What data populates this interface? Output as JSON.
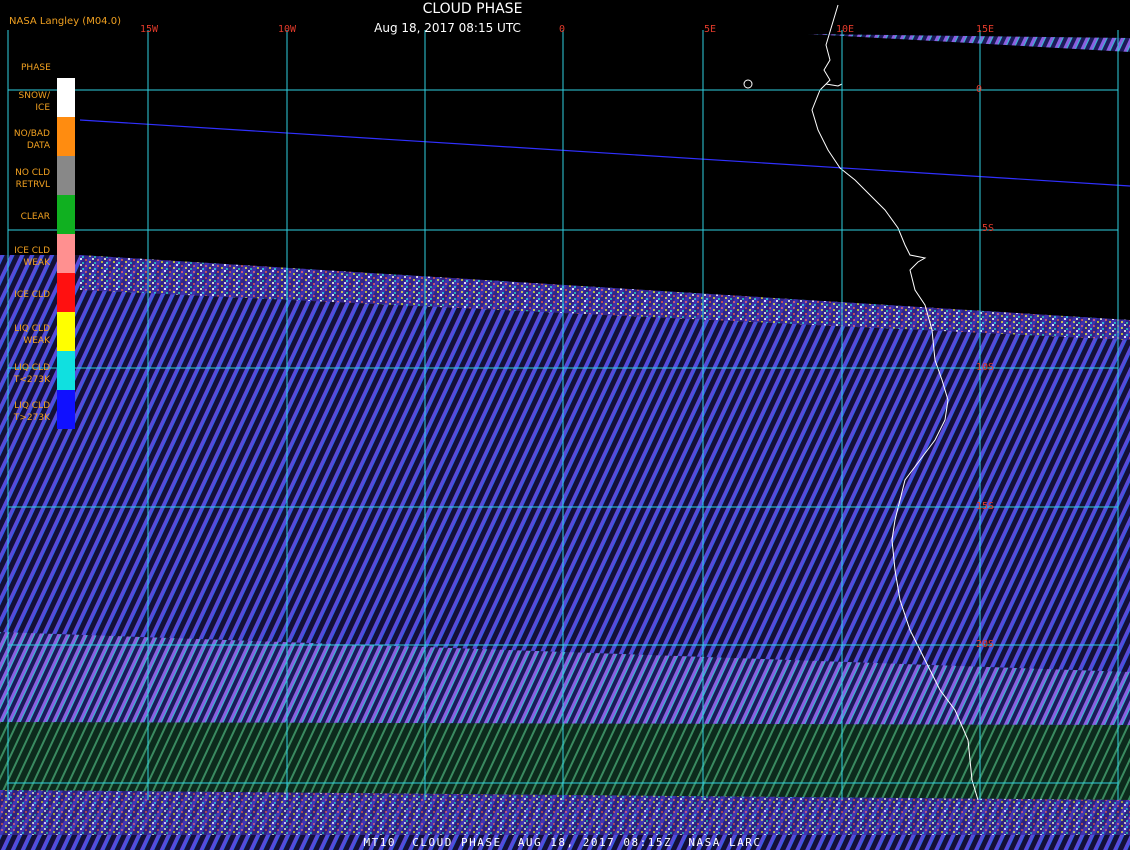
{
  "header": {
    "title": "CLOUD PHASE",
    "subtitle": "Aug 18, 2017 08:15 UTC",
    "credit": "NASA Langley (M04.0)"
  },
  "longitude_labels": [
    {
      "text": "15W",
      "lon": -15
    },
    {
      "text": "10W",
      "lon": -10
    },
    {
      "text": "0",
      "lon": 0
    },
    {
      "text": "5E",
      "lon": 5
    },
    {
      "text": "10E",
      "lon": 10
    },
    {
      "text": "15E",
      "lon": 15
    }
  ],
  "latitude_labels": [
    {
      "text": "0",
      "lat": 0
    },
    {
      "text": "5S",
      "lat": -5
    },
    {
      "text": "10S",
      "lat": -10
    },
    {
      "text": "15S",
      "lat": -15
    },
    {
      "text": "20S",
      "lat": -20
    }
  ],
  "legend": {
    "heading": "PHASE",
    "items": [
      {
        "label_line1": "SNOW/",
        "label_line2": "ICE",
        "color": "#ffffff"
      },
      {
        "label_line1": "NO/BAD",
        "label_line2": "DATA",
        "color": "#ff8c10"
      },
      {
        "label_line1": "NO CLD",
        "label_line2": "RETRVL",
        "color": "#888888"
      },
      {
        "label_line1": "CLEAR",
        "label_line2": "",
        "color": "#10b020"
      },
      {
        "label_line1": "ICE CLD",
        "label_line2": "WEAK",
        "color": "#ff9090"
      },
      {
        "label_line1": "ICE CLD",
        "label_line2": "",
        "color": "#ff1010"
      },
      {
        "label_line1": "LIQ CLD",
        "label_line2": "WEAK",
        "color": "#ffff00"
      },
      {
        "label_line1": "LIQ CLD",
        "label_line2": "T<273K",
        "color": "#10e0e0"
      },
      {
        "label_line1": "LIQ CLD",
        "label_line2": "T>273K",
        "color": "#1010ff"
      }
    ]
  },
  "footer": {
    "text": "MT10  CLOUD PHASE  AUG 18, 2017 08:15Z  NASA LARC"
  },
  "colors": {
    "background": "#000000",
    "grid": "#2fd0e0",
    "tick_labels": "#e23a2a",
    "orbit_track": "#3030ff",
    "coastline": "#ffffff"
  }
}
